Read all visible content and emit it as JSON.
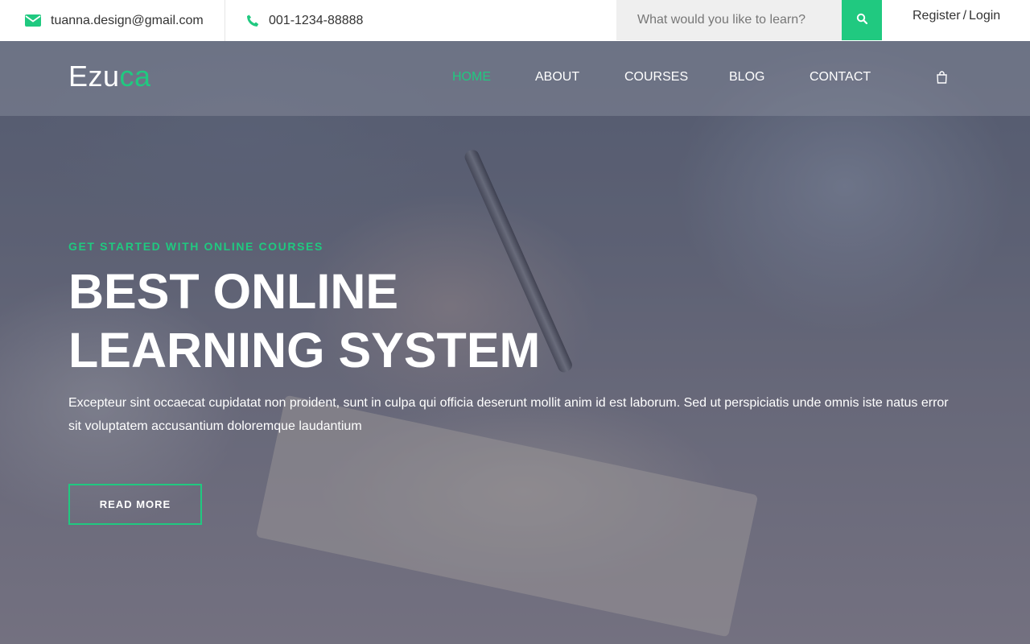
{
  "topbar": {
    "email": "tuanna.design@gmail.com",
    "email_icon": "envelope-icon",
    "phone": "001-1234-88888",
    "phone_icon": "phone-icon",
    "search_placeholder": "What would you like to learn?",
    "search_icon": "search-icon",
    "register_label": "Register",
    "separator": "/",
    "login_label": "Login"
  },
  "nav": {
    "logo_main": "Ezu",
    "logo_accent": "ca",
    "items": [
      {
        "label": "HOME",
        "active": true
      },
      {
        "label": "ABOUT",
        "active": false
      },
      {
        "label": "COURSES",
        "active": false
      },
      {
        "label": "BLOG",
        "active": false
      },
      {
        "label": "CONTACT",
        "active": false
      }
    ],
    "cart_icon": "shopping-bag-icon"
  },
  "hero": {
    "kicker": "GET STARTED WITH ONLINE COURSES",
    "title_line1": "BEST ONLINE",
    "title_line2": "LEARNING SYSTEM",
    "description": "Excepteur sint occaecat cupidatat non proident, sunt in culpa qui officia deserunt mollit anim id est laborum. Sed ut perspiciatis unde omnis iste natus error sit voluptatem accusantium doloremque laudantium",
    "button_label": "READ MORE"
  },
  "colors": {
    "accent": "#20c980",
    "nav_bg": "rgba(140,145,160,0.45)",
    "text_dark": "#333333"
  }
}
